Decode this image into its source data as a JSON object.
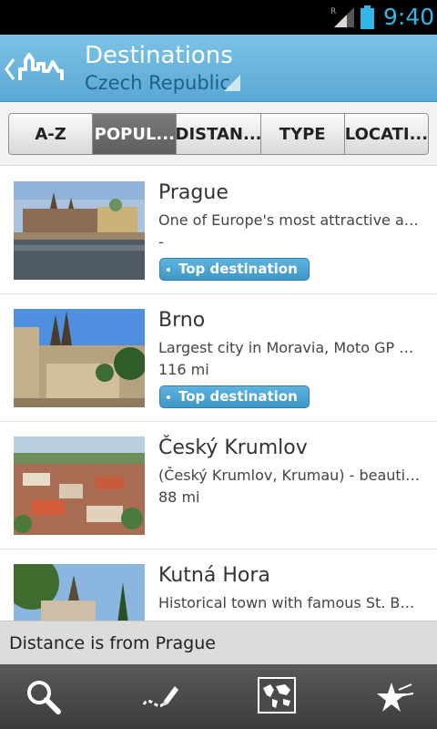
{
  "status_bar": {
    "time": "9:40",
    "network_indicator": "R"
  },
  "action_bar": {
    "title": "Destinations",
    "subtitle": "Czech Republic",
    "back_icon": "chevron-left-icon",
    "logo_icon": "skyline-logo-icon"
  },
  "sort_tabs": [
    {
      "label": "A-Z",
      "active": false
    },
    {
      "label": "POPUL...",
      "active": true
    },
    {
      "label": "DISTAN...",
      "active": false
    },
    {
      "label": "TYPE",
      "active": false
    },
    {
      "label": "LOCATI...",
      "active": false
    }
  ],
  "destinations": [
    {
      "name": "Prague",
      "description": "One of Europe's most attractive an...",
      "distance": "-",
      "badge": "Top destination"
    },
    {
      "name": "Brno",
      "description": "Largest city in Moravia, Moto GP G...",
      "distance": "116 mi",
      "badge": "Top destination"
    },
    {
      "name": "Český Krumlov",
      "description": "(Český Krumlov, Krumau) - beautif...",
      "distance": "88 mi",
      "badge": ""
    },
    {
      "name": "Kutná Hora",
      "description": "Historical town with famous St. Ba...",
      "distance": "",
      "badge": ""
    }
  ],
  "footnote": "Distance is from Prague",
  "bottom_bar": {
    "buttons": [
      "search-icon",
      "draw-route-icon",
      "world-map-icon",
      "favorites-icon"
    ]
  },
  "colors": {
    "accent": "#33b5e5",
    "action_bar": "#6ab6de",
    "badge": "#4aa3d1"
  }
}
